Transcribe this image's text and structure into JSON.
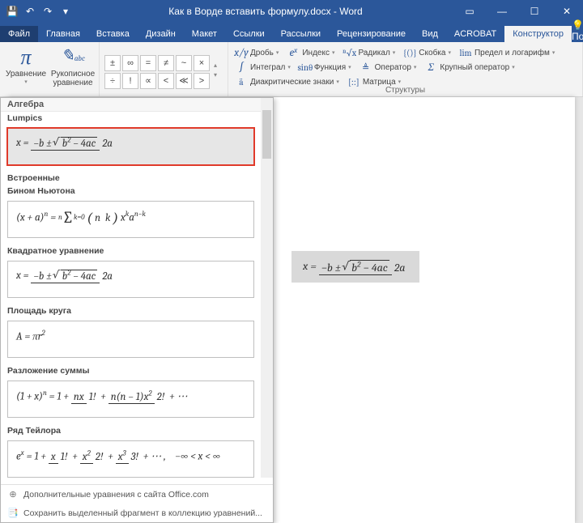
{
  "titlebar": {
    "doc_title": "Как в Ворде вставить формулу.docx - Word"
  },
  "tabs": {
    "file": "Файл",
    "items": [
      "Главная",
      "Вставка",
      "Дизайн",
      "Макет",
      "Ссылки",
      "Рассылки",
      "Рецензирование",
      "Вид",
      "ACROBAT",
      "Конструктор"
    ],
    "active_index": 9,
    "help": "Помощн"
  },
  "ribbon": {
    "equation_btn": "Уравнение",
    "ink_btn": "Рукописное уравнение",
    "symbols": {
      "row1": [
        "±",
        "∞",
        "=",
        "≠",
        "~",
        "×"
      ],
      "row2": [
        "÷",
        "!",
        "∝",
        "<",
        "≪",
        ">"
      ]
    },
    "structs": {
      "fraction": "Дробь",
      "index": "Индекс",
      "radical": "Радикал",
      "integral": "Интеграл",
      "large_op": "Крупный оператор",
      "bracket": "Скобка",
      "function": "Функция",
      "diacritic": "Диакритические знаки",
      "limit_log": "Предел и логарифм",
      "operator": "Оператор",
      "matrix": "Матрица",
      "group_label": "Структуры"
    }
  },
  "gallery": {
    "section_algebra": "Алгебра",
    "cat_lumpics": "Lumpics",
    "cat_builtin": "Встроенные",
    "cat_binomial": "Бином Ньютона",
    "cat_quadratic": "Квадратное уравнение",
    "cat_circle": "Площадь круга",
    "cat_expansion": "Разложение суммы",
    "cat_taylor": "Ряд Тейлора",
    "footer_more": "Дополнительные уравнения с сайта Office.com",
    "footer_save": "Сохранить выделенный фрагмент в коллекцию уравнений..."
  }
}
